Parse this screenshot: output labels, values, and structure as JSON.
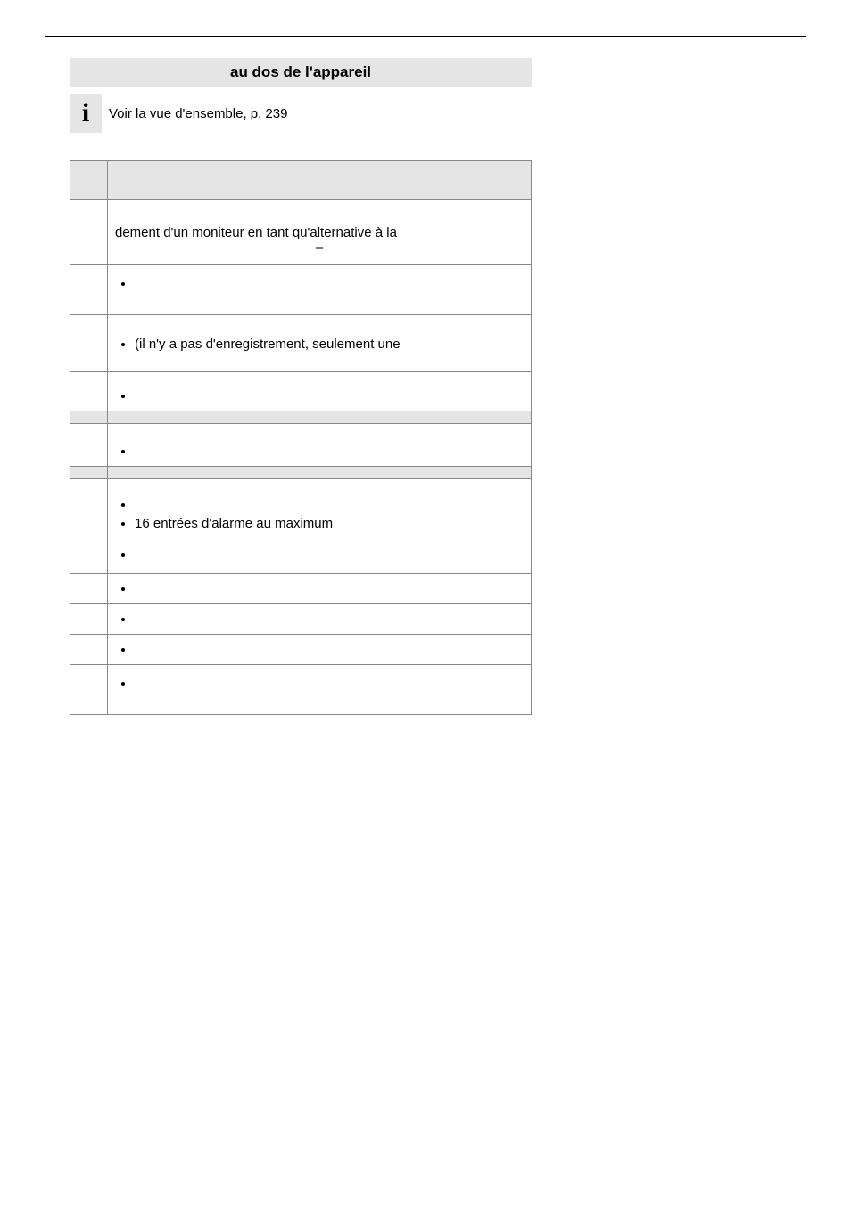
{
  "section_title": "au dos de l'appareil",
  "info_icon": "i",
  "info_text": "Voir la vue d'ensemble, p. 239",
  "rows": {
    "r1": {
      "line1": "dement d'un moniteur en tant qu'alternative à la",
      "dash": "–"
    },
    "r2": {
      "bullet": ""
    },
    "r3": {
      "bullet": "(il n'y a pas d'enregistrement, seulement une"
    },
    "r4": {
      "bullet": ""
    },
    "r5": {
      "bullet": ""
    },
    "r6": {
      "b1": "",
      "b2": "16 entrées d'alarme au maximum",
      "b3": ""
    },
    "r7": {
      "bullet": ""
    },
    "r8": {
      "bullet": ""
    },
    "r9": {
      "bullet": ""
    },
    "r10": {
      "bullet": ""
    }
  }
}
